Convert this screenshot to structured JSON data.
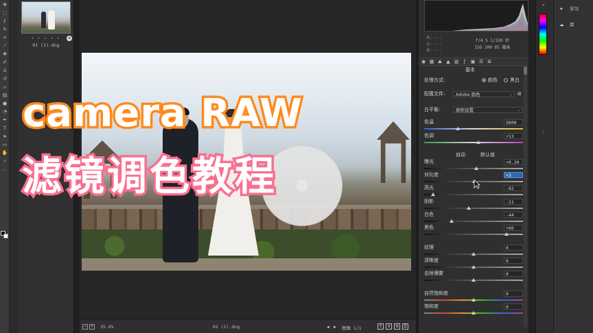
{
  "overlay": {
    "line1": "camera RAW",
    "line2": "滤镜调色教程"
  },
  "filmstrip": {
    "dots": "• • • • •",
    "label": "01 (1).dng",
    "badge": "≡"
  },
  "statusbar": {
    "zoom": "15.6%",
    "filename": "01 (1).dng",
    "image_counter": "图像 1/1"
  },
  "info": {
    "r": "R:  ---",
    "g": "G:  ---",
    "b": "B:  ---",
    "aperture_shutter": "f/4.5  1/320 秒",
    "iso_focal": "ISO 100  85 毫米"
  },
  "panel": {
    "title": "基本",
    "treatment_label": "处理方式:",
    "treatment_color": "颜色",
    "treatment_bw": "黑白",
    "profile_label": "配置文件:",
    "profile_value": "Adobe 颜色",
    "wb_label": "白平衡:",
    "wb_value": "原照设置",
    "auto_label": "自动",
    "default_label": "默认值",
    "sliders": {
      "temp": {
        "label": "色温",
        "value": "5600",
        "pos": 0.34
      },
      "tint": {
        "label": "色调",
        "value": "+13",
        "pos": 0.55
      },
      "exposure": {
        "label": "曝光",
        "value": "+0.30",
        "pos": 0.53
      },
      "contrast": {
        "label": "对比度",
        "value": "+3",
        "pos": 0.51
      },
      "highlights": {
        "label": "高光",
        "value": "-82",
        "pos": 0.09
      },
      "shadows": {
        "label": "阴影",
        "value": "-11",
        "pos": 0.45
      },
      "whites": {
        "label": "白色",
        "value": "-44",
        "pos": 0.28
      },
      "blacks": {
        "label": "黑色",
        "value": "+66",
        "pos": 0.83
      },
      "texture": {
        "label": "纹理",
        "value": "0",
        "pos": 0.5
      },
      "clarity": {
        "label": "清晰度",
        "value": "0",
        "pos": 0.5
      },
      "dehaze": {
        "label": "去除薄雾",
        "value": "0",
        "pos": 0.5
      },
      "vibrance": {
        "label": "自然饱和度",
        "value": "0",
        "pos": 0.5
      },
      "saturation": {
        "label": "饱和度",
        "value": "0",
        "pos": 0.5
      }
    }
  },
  "learn_panel": {
    "learn": "学习",
    "library": "库"
  },
  "icons": {
    "tabs": [
      "aperture-icon",
      "grid-icon",
      "tone-curve-icon",
      "triangle-icon",
      "levels-icon",
      "fx-icon",
      "camera-icon",
      "presets-icon",
      "sliders-icon"
    ]
  },
  "colors": {
    "caption_stroke_1": "#ff8a1c",
    "caption_stroke_2": "#f96f8f",
    "active_field": "#2e69b3"
  }
}
